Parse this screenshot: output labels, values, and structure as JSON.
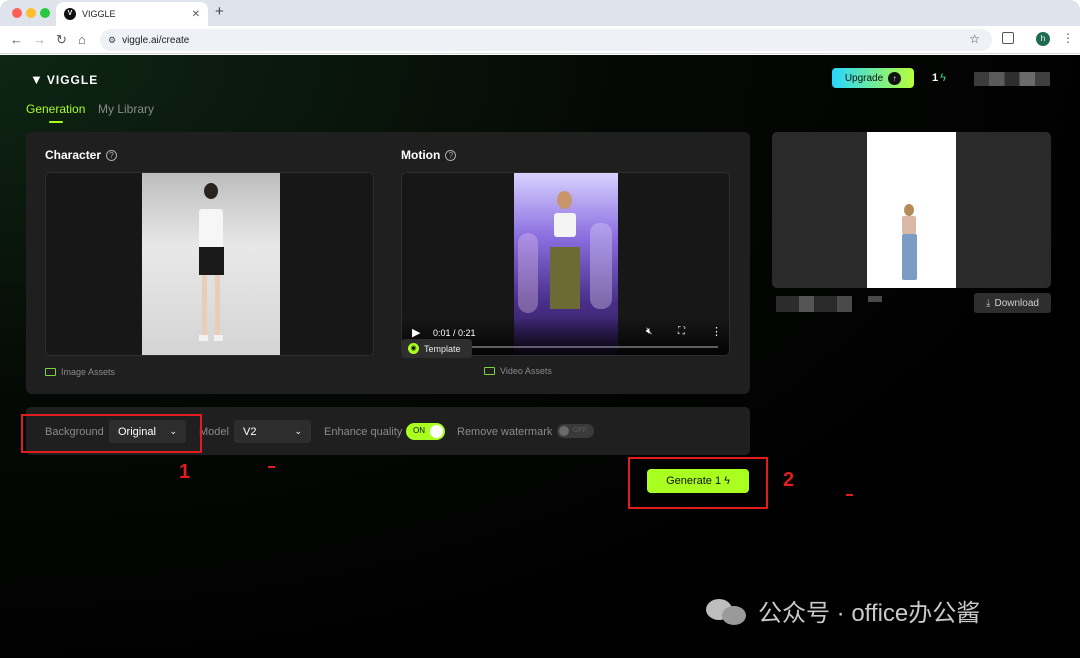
{
  "browser": {
    "tab_title": "VIGGLE",
    "tab_favicon": "V",
    "new_tab": "+",
    "url": "viggle.ai/create",
    "profile_initial": "h"
  },
  "header": {
    "logo_text": "VIGGLE",
    "upgrade_label": "Upgrade",
    "credits": "1"
  },
  "tabs": {
    "generation": "Generation",
    "library": "My Library"
  },
  "character": {
    "title": "Character",
    "asset_link": "Image Assets"
  },
  "motion": {
    "title": "Motion",
    "time": "0:01 / 0:21",
    "progress": 0.05,
    "template_label": "Template",
    "asset_link": "Video Assets"
  },
  "result": {
    "download_label": "Download"
  },
  "options": {
    "background_label": "Background",
    "background_value": "Original",
    "model_label": "Model",
    "model_value": "V2",
    "enhance_label": "Enhance quality",
    "enhance_toggle": "ON",
    "watermark_label": "Remove watermark",
    "watermark_toggle": "OFF"
  },
  "generate": {
    "label": "Generate 1"
  },
  "annotations": {
    "step1": "1",
    "step2": "2"
  },
  "watermark": {
    "text": "公众号 · office办公酱"
  },
  "icons": {
    "back": "back-arrow-icon",
    "forward": "forward-arrow-icon",
    "reload": "reload-icon",
    "home": "home-icon",
    "star": "star-icon",
    "bolt": "bolt-icon",
    "help": "help-circle-icon",
    "folder": "folder-icon",
    "play": "play-icon",
    "mute": "mute-icon",
    "fullscreen": "fullscreen-icon",
    "download": "download-icon"
  },
  "colors": {
    "accent": "#a9ff1f",
    "annotation": "#e11d1d",
    "panel": "#1f1f1f"
  }
}
